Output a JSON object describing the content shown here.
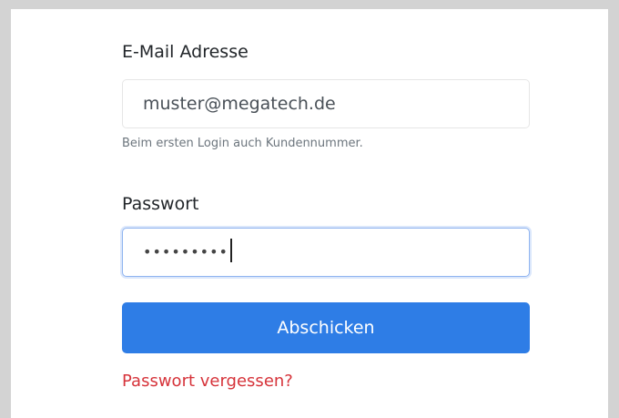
{
  "form": {
    "email_label": "E-Mail Adresse",
    "email_value": "muster@megatech.de",
    "email_help": "Beim ersten Login auch Kundennummer.",
    "password_label": "Passwort",
    "password_masked": "•••••••••",
    "submit_label": "Abschicken",
    "forgot_link": "Passwort vergessen?"
  },
  "colors": {
    "primary": "#2e7de6",
    "link": "#d6333a",
    "background": "#d3d3d3"
  }
}
